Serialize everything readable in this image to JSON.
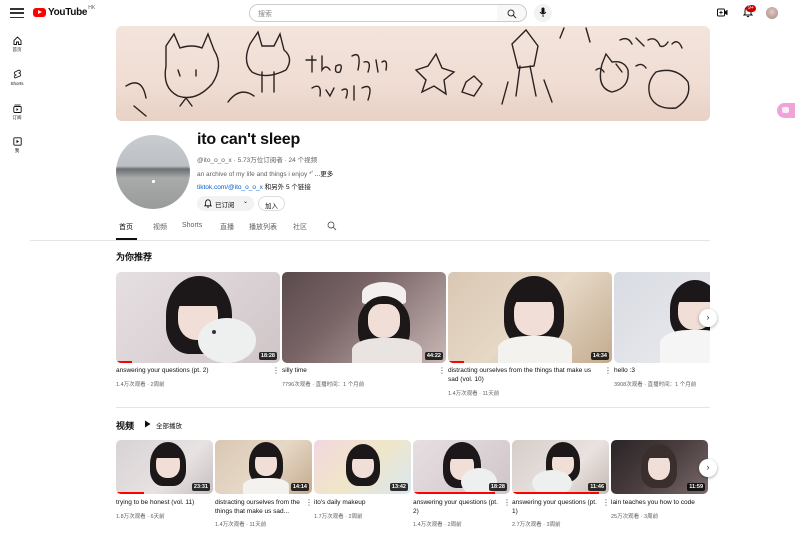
{
  "header": {
    "logo_text": "YouTube",
    "logo_region": "HK",
    "search_placeholder": "搜索",
    "notification_count": "9+"
  },
  "left_rail": [
    {
      "label": "首页",
      "icon": "home-icon"
    },
    {
      "label": "Shorts",
      "icon": "shorts-icon"
    },
    {
      "label": "订阅",
      "icon": "subscriptions-icon"
    },
    {
      "label": "我",
      "icon": "you-icon"
    }
  ],
  "channel": {
    "name": "ito can't sleep",
    "handle": "@ito_o_o_x",
    "subscribers": "5.73万位订阅者",
    "video_count": "24 个视频",
    "description": "an archive of my life and things i enjoy *ﾟ",
    "more": "...更多",
    "link": "tiktok.com/@ito_o_o_x",
    "extra_links": "和另外 5 个链接",
    "subscribed_label": "已订阅",
    "join_label": "加入"
  },
  "tabs": [
    {
      "label": "首页",
      "active": true
    },
    {
      "label": "视频",
      "active": false
    },
    {
      "label": "Shorts",
      "active": false
    },
    {
      "label": "直播",
      "active": false
    },
    {
      "label": "播放列表",
      "active": false
    },
    {
      "label": "社区",
      "active": false
    }
  ],
  "recommended": {
    "title": "为你推荐",
    "videos": [
      {
        "title": "answering your questions (pt. 2)",
        "meta": "1.4万次观看 · 2周前",
        "duration": "18:28",
        "progress": 0.1
      },
      {
        "title": "silly time",
        "meta": "7796次观看 · 直播时间：1 个月前",
        "duration": "44:22",
        "progress": 0
      },
      {
        "title": "distracting ourselves from the things that make us sad (vol. 10)",
        "meta": "1.4万次观看 · 11天前",
        "duration": "14:34",
        "progress": 0.1
      },
      {
        "title": "hello :3",
        "meta": "3908次观看 · 直播时间：1 个月前",
        "duration": "",
        "progress": 0
      }
    ]
  },
  "videos_section": {
    "title": "视频",
    "play_all": "全部播放",
    "videos": [
      {
        "title": "trying to be honest (vol. 11)",
        "meta": "1.8万次观看 · 6天前",
        "duration": "23:31",
        "progress": 0.3
      },
      {
        "title": "distracting ourselves from the things that make us sad...",
        "meta": "1.4万次观看 · 11天前",
        "duration": "14:14",
        "progress": 0
      },
      {
        "title": "ito's daily makeup",
        "meta": "1.7万次观看 · 2周前",
        "duration": "13:42",
        "progress": 0
      },
      {
        "title": "answering your questions (pt. 2)",
        "meta": "1.4万次观看 · 2周前",
        "duration": "18:28",
        "progress": 0.85
      },
      {
        "title": "answering your questions (pt. 1)",
        "meta": "2.7万次观看 · 3周前",
        "duration": "11:46",
        "progress": 0.9
      },
      {
        "title": "lain teaches you how to code",
        "meta": "25万次观看 · 3周前",
        "duration": "11:59",
        "progress": 0
      }
    ]
  },
  "colors": {
    "accent_red": "#ff0000",
    "link_blue": "#065fd4"
  }
}
